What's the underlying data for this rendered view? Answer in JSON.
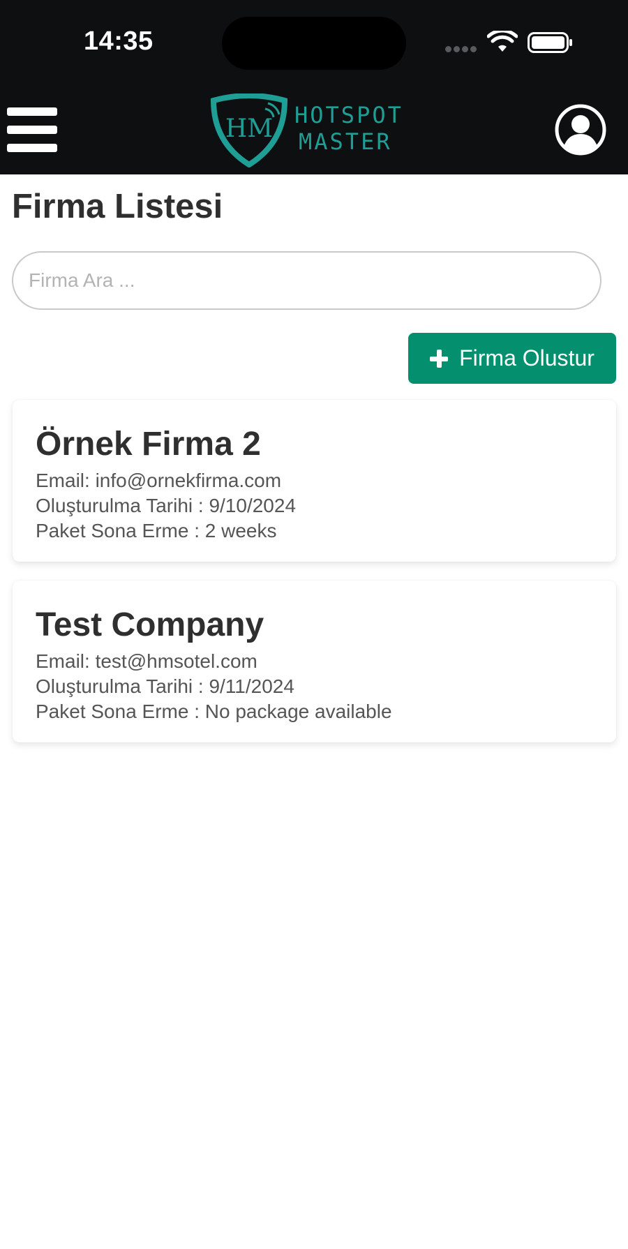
{
  "status_bar": {
    "time": "14:35"
  },
  "header": {
    "logo_text_line1": "HOTSPOT",
    "logo_text_line2": "MASTER",
    "logo_monogram": "HM",
    "brand_color": "#1e9e94",
    "menu_icon": "hamburger-menu-icon",
    "profile_icon": "user-circle-icon"
  },
  "page": {
    "title": "Firma Listesi"
  },
  "search": {
    "placeholder": "Firma Ara ...",
    "value": ""
  },
  "actions": {
    "create_label": "Firma Olustur",
    "create_color": "#04906f"
  },
  "companies": [
    {
      "name": "Örnek Firma 2",
      "email": "Email: info@ornekfirma.com",
      "created": "Oluşturulma Tarihi : 9/10/2024",
      "expiry": "Paket Sona Erme : 2 weeks"
    },
    {
      "name": "Test Company",
      "email": "Email: test@hmsotel.com",
      "created": "Oluşturulma Tarihi : 9/11/2024",
      "expiry": "Paket Sona Erme : No package available"
    }
  ]
}
